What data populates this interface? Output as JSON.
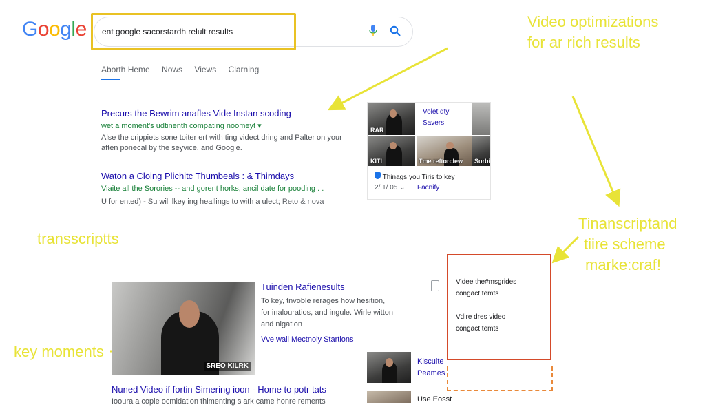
{
  "logo": {
    "letters": [
      "G",
      "o",
      "o",
      "g",
      "l",
      "e"
    ],
    "colors": [
      "#4285F4",
      "#EA4335",
      "#FBBC05",
      "#4285F4",
      "#34A853",
      "#EA4335"
    ]
  },
  "search": {
    "query": "ent google sacorstardh relult results"
  },
  "tabs": [
    "Aborth Heme",
    "Nows",
    "Views",
    "Clarning"
  ],
  "results": [
    {
      "title": "Precurs the Bewrim anafles Vide Instan scoding",
      "url": "wet a moment's udtinenth compating noomeyt",
      "snippet1": "Alse the crippiets sone toiter ert with ting videct dring and Palter on your",
      "snippet2": "aften ponecal by the seyvice. and Google."
    },
    {
      "title": "Waton a Cloing Plichitc Thumbeals : & Thimdays",
      "url": "Viaite all the Sorories -- and gorent horks, ancil date for pooding . .",
      "snippet1": "U for ented) - Su will lkey ing heallings to with a ulect;",
      "link": "Reto & nova"
    }
  ],
  "video_panel": {
    "title1": "Volet dty",
    "title2": "Savers",
    "cap1": "RAR",
    "cap2": "KITI",
    "cap3": "Tme reftorclew",
    "cap4": "Sorbi",
    "item_text": "Thinags you Tiris to key",
    "meta": "2/ 1/ 05",
    "meta_link": "Facnify"
  },
  "annotations": {
    "top_right_1": "Video optimizations",
    "top_right_2": "for ar rich results",
    "mid_right_1": "Tinanscriptand",
    "mid_right_2": "tiire scheme",
    "mid_right_3": "marke:craf!",
    "transcripts": "transscriptts",
    "key_moments": "key moments",
    "accent_yellow": "#e8e337",
    "accent_red": "#d44a2a"
  },
  "red_box": {
    "line1": "Videe the#msgrides",
    "line2": "congact temts",
    "line3": "Vdire dres video",
    "line4": "congact temts"
  },
  "video_result": {
    "title": "Tuinden Rafienesults",
    "snippet1": "To key, tnvoble rerages how hesition,",
    "snippet2": "for inalouratios, and ingule. Wirle witton",
    "snippet3": "and nigation",
    "link": "Vve wall Mectnoly Startions",
    "caption": "SREO KILRK"
  },
  "side_items": [
    {
      "l1": "Kiscuite",
      "l2": "Peames"
    },
    {
      "l1": "Use Eosst"
    }
  ],
  "bottom_result": {
    "title": "Nuned Video if fortin Simering ioon - Home to potr tats",
    "snippet": "Iooura a cople ocmidation thimenting s ark came honre rements"
  }
}
